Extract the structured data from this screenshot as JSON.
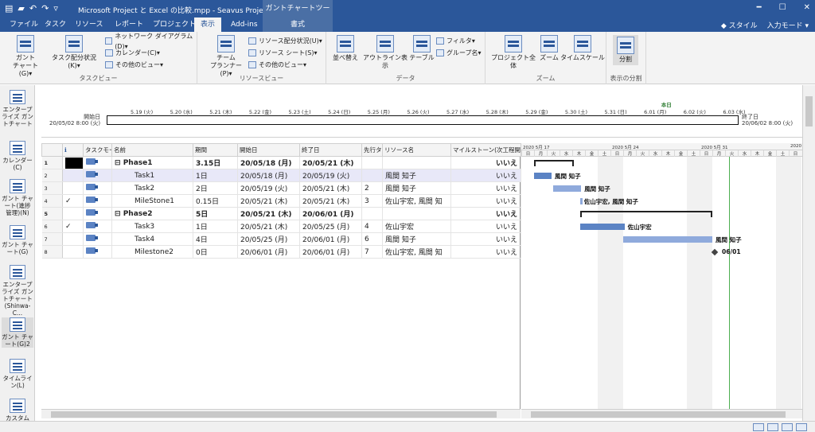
{
  "titlebar": {
    "title": "Microsoft Project と Excel の比較.mpp - Seavus Project Viewer",
    "context_tab": "ガントチャートツール",
    "minimize": "━",
    "maximize": "☐",
    "close": "✕"
  },
  "tabs": [
    "ファイル",
    "タスク",
    "リソース",
    "レポート",
    "プロジェクト",
    "表示",
    "Add-ins",
    "書式"
  ],
  "tab_links": {
    "style": "◆ スタイル",
    "input_mode": "入力モード ▾"
  },
  "ribbon": {
    "task_view": {
      "label": "タスクビュー",
      "gantt": "ガント\nチャート(G)▾",
      "usage": "タスク配分状況(K)▾",
      "network": "ネットワーク ダイアグラム(D)▾",
      "calendar": "カレンダー(C)▾",
      "other": "その他のビュー▾"
    },
    "resource_view": {
      "label": "リソースビュー",
      "team": "チーム\nプランナー(P)▾",
      "res_usage": "リソース配分状況(U)▾",
      "res_sheet": "リソース シート(S)▾",
      "other": "その他のビュー▾"
    },
    "data": {
      "label": "データ",
      "sort": "並べ替え",
      "outline": "アウトライン表示",
      "table": "テーブル",
      "filter": "フィルタ▾",
      "group": "グループ名▾"
    },
    "zoom": {
      "label": "ズーム",
      "entire": "プロジェクト全体",
      "zoom": "ズーム",
      "timescale": "タイムスケール"
    },
    "split": {
      "label": "表示の分割",
      "btn": "分割"
    }
  },
  "leftbar": [
    "エンタープライズ ガントチャート",
    "カレンダー(C)",
    "ガント チャート(進捗管理)(N)",
    "ガント チャート(G)",
    "エンタープライズ ガントチャート (Shinwa-C...",
    "ガント チャート(G)2",
    "タイムライン(L)",
    "カスタム"
  ],
  "timeline": {
    "start_label": "開始日",
    "start_date": "20/05/02 8:00 (火)",
    "end_label": "終了日",
    "end_date": "20/06/02 8:00 (火)",
    "today": "本日",
    "dates": [
      "5.19 (火)",
      "5.20 (水)",
      "5.21 (木)",
      "5.22 (金)",
      "5.23 (土)",
      "5.24 (日)",
      "5.25 (月)",
      "5.26 (火)",
      "5.27 (水)",
      "5.28 (木)",
      "5.29 (金)",
      "5.30 (土)",
      "5.31 (日)",
      "6.01 (月)",
      "6.02 (火)",
      "6.03 (水)"
    ]
  },
  "table": {
    "headers": [
      "",
      "ℹ",
      "タスクモード",
      "名前",
      "期間",
      "開始日",
      "終了日",
      "先行タスク",
      "リソース名",
      "マイルストーン(次工程開始可)"
    ],
    "rows": [
      {
        "n": "1",
        "check": "",
        "name": "Phase1",
        "dur": "3.15日",
        "start": "20/05/18 (月)",
        "finish": "20/05/21 (木)",
        "pred": "",
        "res": "",
        "ms": "いいえ",
        "summary": true
      },
      {
        "n": "2",
        "check": "",
        "name": "Task1",
        "dur": "1日",
        "start": "20/05/18 (月)",
        "finish": "20/05/19 (火)",
        "pred": "",
        "res": "風間 知子",
        "ms": "いいえ",
        "summary": false
      },
      {
        "n": "3",
        "check": "",
        "name": "Task2",
        "dur": "2日",
        "start": "20/05/19 (火)",
        "finish": "20/05/21 (木)",
        "pred": "2",
        "res": "風間 知子",
        "ms": "いいえ",
        "summary": false
      },
      {
        "n": "4",
        "check": "✓",
        "name": "MileStone1",
        "dur": "0.15日",
        "start": "20/05/21 (木)",
        "finish": "20/05/21 (木)",
        "pred": "3",
        "res": "佐山宇宏, 風間 知",
        "ms": "いいえ",
        "summary": false
      },
      {
        "n": "5",
        "check": "",
        "name": "Phase2",
        "dur": "5日",
        "start": "20/05/21 (木)",
        "finish": "20/06/01 (月)",
        "pred": "",
        "res": "",
        "ms": "いいえ",
        "summary": true
      },
      {
        "n": "6",
        "check": "✓",
        "name": "Task3",
        "dur": "1日",
        "start": "20/05/21 (木)",
        "finish": "20/05/25 (月)",
        "pred": "4",
        "res": "佐山宇宏",
        "ms": "いいえ",
        "summary": false
      },
      {
        "n": "7",
        "check": "",
        "name": "Task4",
        "dur": "4日",
        "start": "20/05/25 (月)",
        "finish": "20/06/01 (月)",
        "pred": "6",
        "res": "風間 知子",
        "ms": "いいえ",
        "summary": false
      },
      {
        "n": "8",
        "check": "",
        "name": "Milestone2",
        "dur": "0日",
        "start": "20/06/01 (月)",
        "finish": "20/06/01 (月)",
        "pred": "7",
        "res": "佐山宇宏, 風間 知",
        "ms": "いいえ",
        "summary": false
      }
    ]
  },
  "gantt": {
    "weeks": [
      "2020 5月 17",
      "2020 5月 24",
      "2020 5月 31",
      "2020"
    ],
    "days": [
      "日",
      "月",
      "火",
      "水",
      "木",
      "金",
      "土"
    ],
    "labels": {
      "task1": "風間 知子",
      "task2": "風間 知子",
      "ms1": "佐山宇宏, 風間 知子",
      "task3": "佐山宇宏",
      "task4": "風間 知子",
      "ms2": "06/01"
    }
  }
}
